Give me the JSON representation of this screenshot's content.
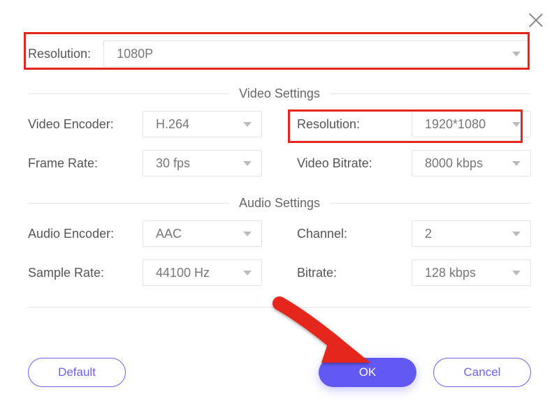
{
  "close": {
    "name": "close"
  },
  "top": {
    "label": "Resolution:",
    "value": "1080P"
  },
  "videoSection": {
    "title": "Video Settings",
    "encoder": {
      "label": "Video Encoder:",
      "value": "H.264"
    },
    "resolution": {
      "label": "Resolution:",
      "value": "1920*1080"
    },
    "framerate": {
      "label": "Frame Rate:",
      "value": "30 fps"
    },
    "bitrate": {
      "label": "Video Bitrate:",
      "value": "8000 kbps"
    }
  },
  "audioSection": {
    "title": "Audio Settings",
    "encoder": {
      "label": "Audio Encoder:",
      "value": "AAC"
    },
    "channel": {
      "label": "Channel:",
      "value": "2"
    },
    "samplerate": {
      "label": "Sample Rate:",
      "value": "44100 Hz"
    },
    "bitrate": {
      "label": "Bitrate:",
      "value": "128 kbps"
    }
  },
  "buttons": {
    "default": "Default",
    "ok": "OK",
    "cancel": "Cancel"
  }
}
